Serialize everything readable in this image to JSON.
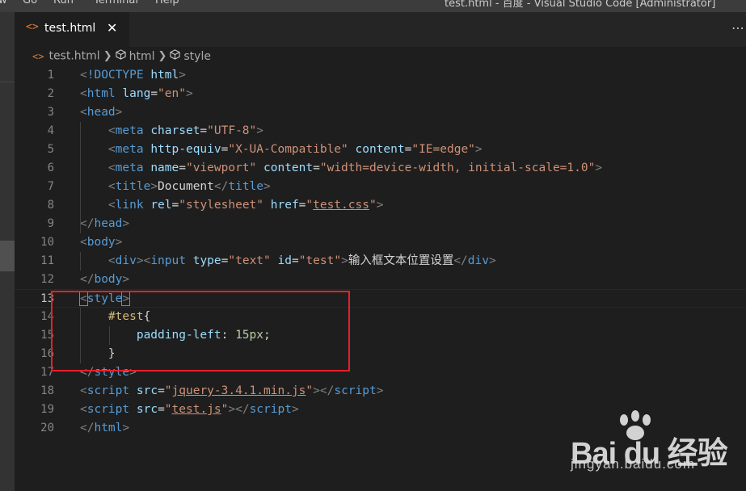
{
  "menubar": {
    "items": [
      "w",
      "Go",
      "Run",
      "Terminal",
      "Help"
    ],
    "title": "test.html - 百度 - Visual Studio Code [Administrator]"
  },
  "tabs": [
    {
      "icon": "<>",
      "label": "test.html",
      "close": "✕"
    }
  ],
  "breadcrumb": {
    "file": "test.html",
    "items": [
      "html",
      "style"
    ]
  },
  "editor": {
    "active_line": 13,
    "lines": [
      {
        "n": "1",
        "tokens": [
          [
            "pun",
            "<"
          ],
          [
            "tag",
            "!DOCTYPE"
          ],
          [
            "txt",
            " "
          ],
          [
            "att",
            "html"
          ],
          [
            "pun",
            ">"
          ]
        ]
      },
      {
        "n": "2",
        "tokens": [
          [
            "pun",
            "<"
          ],
          [
            "tag",
            "html"
          ],
          [
            "txt",
            " "
          ],
          [
            "att",
            "lang"
          ],
          [
            "txt",
            "="
          ],
          [
            "str",
            "\"en\""
          ],
          [
            "pun",
            ">"
          ]
        ]
      },
      {
        "n": "3",
        "tokens": [
          [
            "pun",
            "<"
          ],
          [
            "tag",
            "head"
          ],
          [
            "pun",
            ">"
          ]
        ]
      },
      {
        "n": "4",
        "tokens": [
          [
            "txt",
            "    "
          ],
          [
            "pun",
            "<"
          ],
          [
            "tag",
            "meta"
          ],
          [
            "txt",
            " "
          ],
          [
            "att",
            "charset"
          ],
          [
            "txt",
            "="
          ],
          [
            "str",
            "\"UTF-8\""
          ],
          [
            "pun",
            ">"
          ]
        ]
      },
      {
        "n": "5",
        "tokens": [
          [
            "txt",
            "    "
          ],
          [
            "pun",
            "<"
          ],
          [
            "tag",
            "meta"
          ],
          [
            "txt",
            " "
          ],
          [
            "att",
            "http-equiv"
          ],
          [
            "txt",
            "="
          ],
          [
            "str",
            "\"X-UA-Compatible\""
          ],
          [
            "txt",
            " "
          ],
          [
            "att",
            "content"
          ],
          [
            "txt",
            "="
          ],
          [
            "str",
            "\"IE=edge\""
          ],
          [
            "pun",
            ">"
          ]
        ]
      },
      {
        "n": "6",
        "tokens": [
          [
            "txt",
            "    "
          ],
          [
            "pun",
            "<"
          ],
          [
            "tag",
            "meta"
          ],
          [
            "txt",
            " "
          ],
          [
            "att",
            "name"
          ],
          [
            "txt",
            "="
          ],
          [
            "str",
            "\"viewport\""
          ],
          [
            "txt",
            " "
          ],
          [
            "att",
            "content"
          ],
          [
            "txt",
            "="
          ],
          [
            "str",
            "\"width=device-width, initial-scale=1.0\""
          ],
          [
            "pun",
            ">"
          ]
        ]
      },
      {
        "n": "7",
        "tokens": [
          [
            "txt",
            "    "
          ],
          [
            "pun",
            "<"
          ],
          [
            "tag",
            "title"
          ],
          [
            "pun",
            ">"
          ],
          [
            "txt",
            "Document"
          ],
          [
            "pun",
            "</"
          ],
          [
            "tag",
            "title"
          ],
          [
            "pun",
            ">"
          ]
        ]
      },
      {
        "n": "8",
        "tokens": [
          [
            "txt",
            "    "
          ],
          [
            "pun",
            "<"
          ],
          [
            "tag",
            "link"
          ],
          [
            "txt",
            " "
          ],
          [
            "att",
            "rel"
          ],
          [
            "txt",
            "="
          ],
          [
            "str",
            "\"stylesheet\""
          ],
          [
            "txt",
            " "
          ],
          [
            "att",
            "href"
          ],
          [
            "txt",
            "="
          ],
          [
            "str",
            "\""
          ],
          [
            "strlink",
            "test.css"
          ],
          [
            "str",
            "\""
          ],
          [
            "pun",
            ">"
          ]
        ]
      },
      {
        "n": "9",
        "tokens": [
          [
            "pun",
            "</"
          ],
          [
            "tag",
            "head"
          ],
          [
            "pun",
            ">"
          ]
        ]
      },
      {
        "n": "10",
        "tokens": [
          [
            "pun",
            "<"
          ],
          [
            "tag",
            "body"
          ],
          [
            "pun",
            ">"
          ]
        ]
      },
      {
        "n": "11",
        "tokens": [
          [
            "txt",
            "    "
          ],
          [
            "pun",
            "<"
          ],
          [
            "tag",
            "div"
          ],
          [
            "pun",
            "><"
          ],
          [
            "tag",
            "input"
          ],
          [
            "txt",
            " "
          ],
          [
            "att",
            "type"
          ],
          [
            "txt",
            "="
          ],
          [
            "str",
            "\"text\""
          ],
          [
            "txt",
            " "
          ],
          [
            "att",
            "id"
          ],
          [
            "txt",
            "="
          ],
          [
            "str",
            "\"test\""
          ],
          [
            "pun",
            ">"
          ],
          [
            "txt",
            "输入框文本位置设置"
          ],
          [
            "pun",
            "</"
          ],
          [
            "tag",
            "div"
          ],
          [
            "pun",
            ">"
          ]
        ]
      },
      {
        "n": "12",
        "tokens": [
          [
            "pun",
            "</"
          ],
          [
            "tag",
            "body"
          ],
          [
            "pun",
            ">"
          ]
        ]
      },
      {
        "n": "13",
        "tokens": [
          [
            "punbox",
            "<"
          ],
          [
            "tag",
            "style"
          ],
          [
            "punbox",
            ">"
          ]
        ]
      },
      {
        "n": "14",
        "tokens": [
          [
            "txt",
            "    "
          ],
          [
            "sel",
            "#test"
          ],
          [
            "txt",
            "{"
          ]
        ]
      },
      {
        "n": "15",
        "tokens": [
          [
            "txt",
            "        "
          ],
          [
            "prop",
            "padding-left"
          ],
          [
            "txt",
            ": "
          ],
          [
            "num",
            "15px"
          ],
          [
            "txt",
            ";"
          ]
        ]
      },
      {
        "n": "16",
        "tokens": [
          [
            "txt",
            "    }"
          ]
        ]
      },
      {
        "n": "17",
        "tokens": [
          [
            "pun",
            "</"
          ],
          [
            "tag",
            "style"
          ],
          [
            "pun",
            ">"
          ]
        ]
      },
      {
        "n": "18",
        "tokens": [
          [
            "pun",
            "<"
          ],
          [
            "tag",
            "script"
          ],
          [
            "txt",
            " "
          ],
          [
            "att",
            "src"
          ],
          [
            "txt",
            "="
          ],
          [
            "str",
            "\""
          ],
          [
            "strlink",
            "jquery-3.4.1.min.js"
          ],
          [
            "str",
            "\""
          ],
          [
            "pun",
            "></"
          ],
          [
            "tag",
            "script"
          ],
          [
            "pun",
            ">"
          ]
        ]
      },
      {
        "n": "19",
        "tokens": [
          [
            "pun",
            "<"
          ],
          [
            "tag",
            "script"
          ],
          [
            "txt",
            " "
          ],
          [
            "att",
            "src"
          ],
          [
            "txt",
            "="
          ],
          [
            "str",
            "\""
          ],
          [
            "strlink",
            "test.js"
          ],
          [
            "str",
            "\""
          ],
          [
            "pun",
            "></"
          ],
          [
            "tag",
            "script"
          ],
          [
            "pun",
            ">"
          ]
        ]
      },
      {
        "n": "20",
        "tokens": [
          [
            "pun",
            "</"
          ],
          [
            "tag",
            "html"
          ],
          [
            "pun",
            ">"
          ]
        ]
      }
    ]
  },
  "watermark": {
    "brand": "Bai du 经验",
    "url": "jingyan.baidu.com"
  },
  "colors": {
    "accent_red": "#e8202a",
    "tag": "#569cd6",
    "attribute": "#9cdcfe",
    "string": "#ce9178",
    "selector": "#d7ba7d",
    "number": "#b5cea8"
  }
}
